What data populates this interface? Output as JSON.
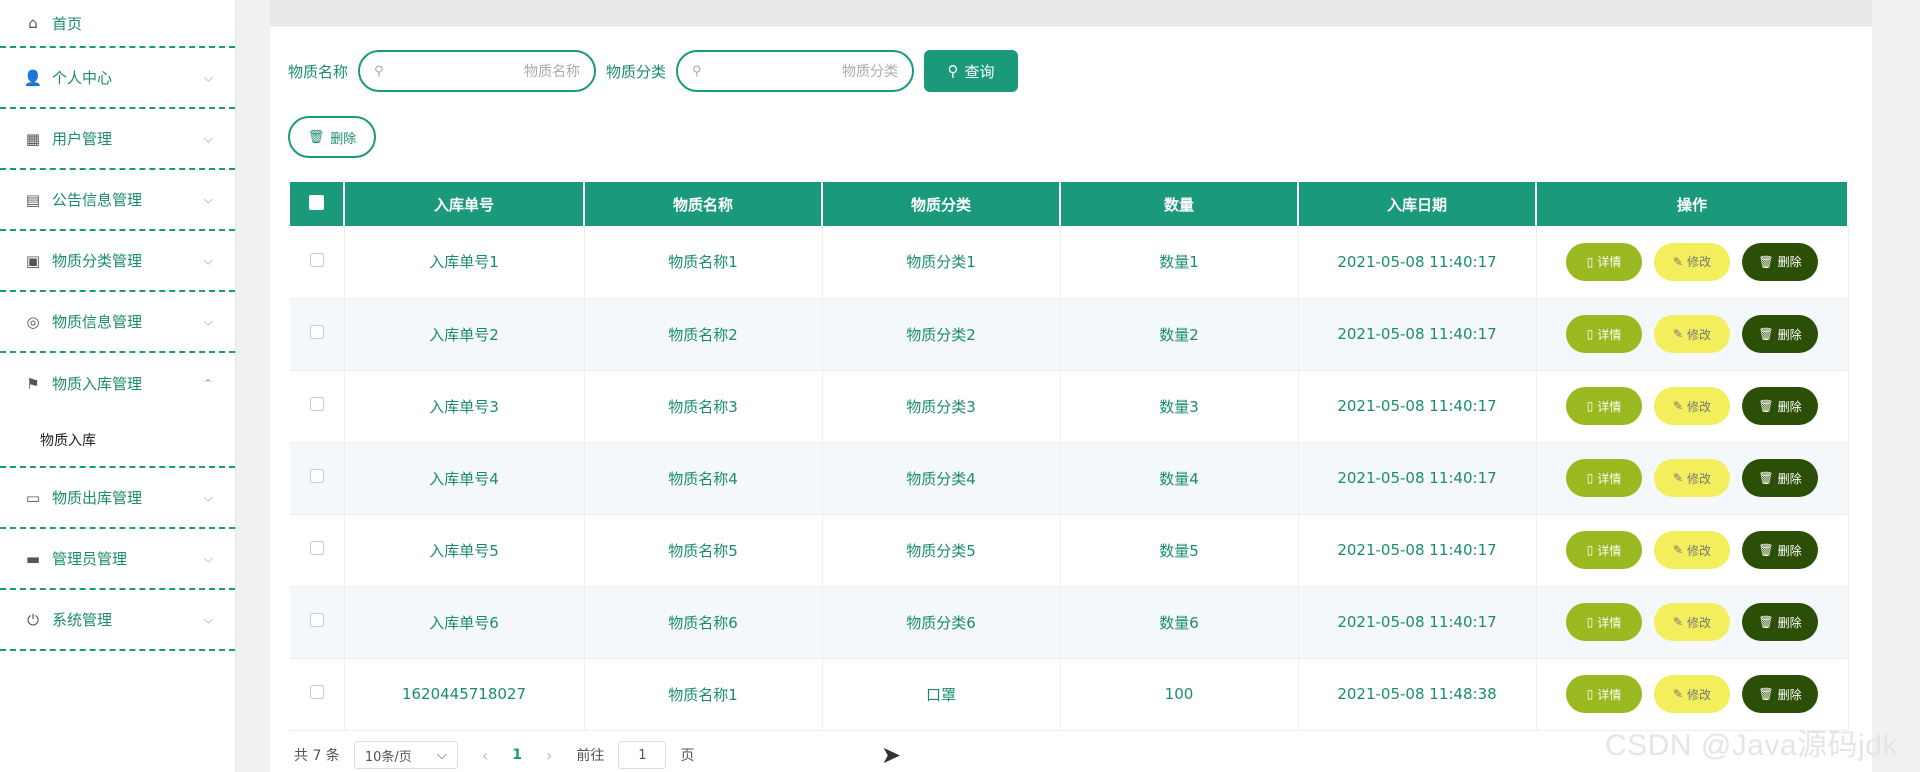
{
  "sidebar": {
    "items": [
      {
        "label": "首页",
        "icon": "home-icon",
        "glyph": "⌂",
        "chevron": ""
      },
      {
        "label": "个人中心",
        "icon": "user-icon",
        "glyph": "👤",
        "chevron": "⌵"
      },
      {
        "label": "用户管理",
        "icon": "chart-icon",
        "glyph": "▦",
        "chevron": "⌵"
      },
      {
        "label": "公告信息管理",
        "icon": "clipboard-icon",
        "glyph": "▤",
        "chevron": "⌵"
      },
      {
        "label": "物质分类管理",
        "icon": "briefcase-icon",
        "glyph": "▣",
        "chevron": "⌵"
      },
      {
        "label": "物质信息管理",
        "icon": "compass-icon",
        "glyph": "◎",
        "chevron": "⌵"
      },
      {
        "label": "物质入库管理",
        "icon": "flag-icon",
        "glyph": "⚑",
        "chevron": "⌃"
      },
      {
        "label": "物质出库管理",
        "icon": "message-icon",
        "glyph": "▭",
        "chevron": "⌵"
      },
      {
        "label": "管理员管理",
        "icon": "cart-icon",
        "glyph": "▬",
        "chevron": "⌵"
      },
      {
        "label": "系统管理",
        "icon": "power-icon",
        "glyph": "⏻",
        "chevron": "⌵"
      }
    ],
    "submenu": "物质入库"
  },
  "search": {
    "name_label": "物质名称",
    "name_placeholder": "物质名称",
    "category_label": "物质分类",
    "category_placeholder": "物质分类",
    "search_button": "查询",
    "delete_button": "删除"
  },
  "table": {
    "headers": [
      "入库单号",
      "物质名称",
      "物质分类",
      "数量",
      "入库日期",
      "操作"
    ],
    "rows": [
      {
        "id": "入库单号1",
        "name": "物质名称1",
        "category": "物质分类1",
        "qty": "数量1",
        "date": "2021-05-08 11:40:17"
      },
      {
        "id": "入库单号2",
        "name": "物质名称2",
        "category": "物质分类2",
        "qty": "数量2",
        "date": "2021-05-08 11:40:17"
      },
      {
        "id": "入库单号3",
        "name": "物质名称3",
        "category": "物质分类3",
        "qty": "数量3",
        "date": "2021-05-08 11:40:17"
      },
      {
        "id": "入库单号4",
        "name": "物质名称4",
        "category": "物质分类4",
        "qty": "数量4",
        "date": "2021-05-08 11:40:17"
      },
      {
        "id": "入库单号5",
        "name": "物质名称5",
        "category": "物质分类5",
        "qty": "数量5",
        "date": "2021-05-08 11:40:17"
      },
      {
        "id": "入库单号6",
        "name": "物质名称6",
        "category": "物质分类6",
        "qty": "数量6",
        "date": "2021-05-08 11:40:17"
      },
      {
        "id": "1620445718027",
        "name": "物质名称1",
        "category": "口罩",
        "qty": "100",
        "date": "2021-05-08 11:48:38"
      }
    ],
    "ops": {
      "detail": "详情",
      "edit": "修改",
      "delete": "删除"
    }
  },
  "pager": {
    "total": "共 7 条",
    "page_size": "10条/页",
    "current": "1",
    "goto_label": "前往",
    "goto_value": "1",
    "page_suffix": "页"
  },
  "watermark": "CSDN @Java源码jdk",
  "colors": {
    "primary": "#1a9a7a",
    "detail": "#9ab820",
    "edit": "#f3ee5c",
    "delete": "#2c4f08"
  }
}
